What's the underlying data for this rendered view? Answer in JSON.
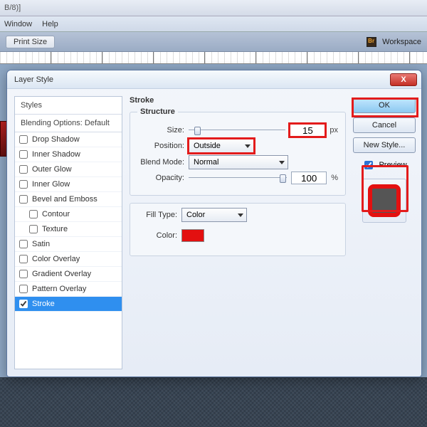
{
  "window": {
    "title_fragment": "B/8)]"
  },
  "menu": {
    "window": "Window",
    "help": "Help"
  },
  "toolbar": {
    "print_size": "Print Size",
    "workspace": "Workspace"
  },
  "dialog": {
    "title": "Layer Style",
    "left": {
      "styles_header": "Styles",
      "blending_header": "Blending Options: Default",
      "items": [
        {
          "label": "Drop Shadow",
          "checked": false,
          "sub": false
        },
        {
          "label": "Inner Shadow",
          "checked": false,
          "sub": false
        },
        {
          "label": "Outer Glow",
          "checked": false,
          "sub": false
        },
        {
          "label": "Inner Glow",
          "checked": false,
          "sub": false
        },
        {
          "label": "Bevel and Emboss",
          "checked": false,
          "sub": false
        },
        {
          "label": "Contour",
          "checked": false,
          "sub": true
        },
        {
          "label": "Texture",
          "checked": false,
          "sub": true
        },
        {
          "label": "Satin",
          "checked": false,
          "sub": false
        },
        {
          "label": "Color Overlay",
          "checked": false,
          "sub": false
        },
        {
          "label": "Gradient Overlay",
          "checked": false,
          "sub": false
        },
        {
          "label": "Pattern Overlay",
          "checked": false,
          "sub": false
        },
        {
          "label": "Stroke",
          "checked": true,
          "sub": false,
          "selected": true
        }
      ]
    },
    "stroke": {
      "section": "Stroke",
      "structure_legend": "Structure",
      "size_label": "Size:",
      "size_value": "15",
      "size_unit": "px",
      "position_label": "Position:",
      "position_value": "Outside",
      "blend_label": "Blend Mode:",
      "blend_value": "Normal",
      "opacity_label": "Opacity:",
      "opacity_value": "100",
      "opacity_unit": "%",
      "filltype_label": "Fill Type:",
      "filltype_value": "Color",
      "color_label": "Color:",
      "color_hex": "#e31010"
    },
    "buttons": {
      "ok": "OK",
      "cancel": "Cancel",
      "new_style": "New Style...",
      "preview": "Preview"
    }
  }
}
